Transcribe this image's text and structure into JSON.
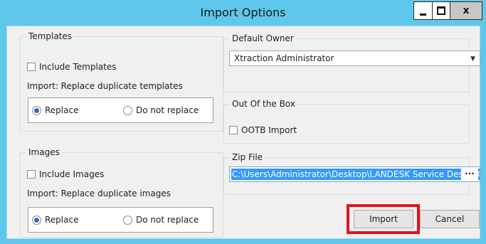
{
  "window": {
    "title": "Import Options",
    "close_glyph": "x"
  },
  "templates": {
    "legend": "Templates",
    "include_label": "Include Templates",
    "include_checked": false,
    "duplicate_label": "Import: Replace duplicate templates",
    "radio_replace": "Replace",
    "radio_not_replace": "Do not replace",
    "selected": "Replace"
  },
  "images": {
    "legend": "Images",
    "include_label": "Include Images",
    "include_checked": false,
    "duplicate_label": "Import: Replace duplicate images",
    "radio_replace": "Replace",
    "radio_not_replace": "Do not replace",
    "selected": "Replace"
  },
  "default_owner": {
    "legend": "Default Owner",
    "value": "Xtraction Administrator"
  },
  "ootb": {
    "legend": "Out Of the Box",
    "checkbox_label": "OOTB Import",
    "checked": false
  },
  "zip": {
    "legend": "Zip File",
    "value": "C:\\Users\\Administrator\\Desktop\\LANDESK Service Desk OOT",
    "browse_label": "···"
  },
  "buttons": {
    "import": "Import",
    "cancel": "Cancel"
  },
  "colors": {
    "title_bar": "#5fc7ea",
    "highlight": "#e0141e",
    "selection": "#3399ff"
  },
  "icons": [
    "minimize-icon",
    "maximize-icon",
    "close-icon",
    "dropdown-arrow-icon"
  ]
}
